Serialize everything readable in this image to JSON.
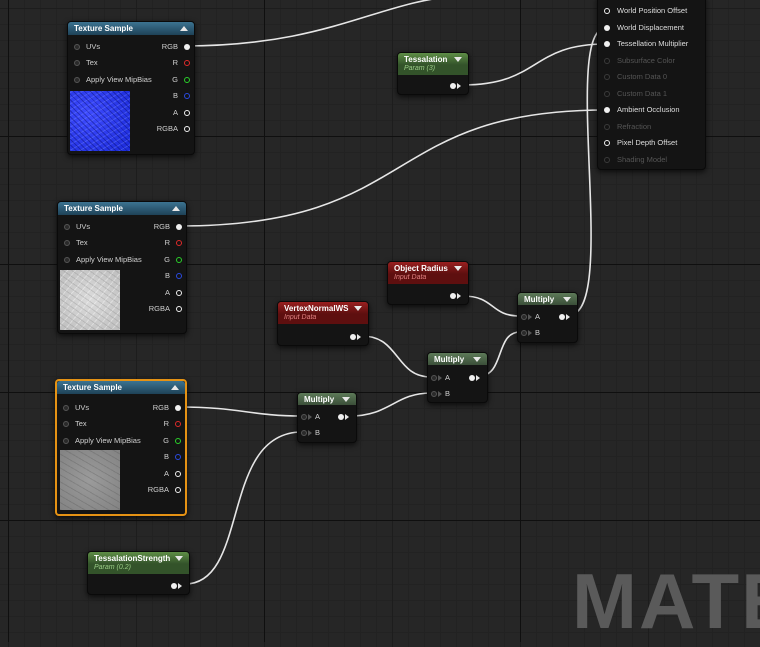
{
  "watermark": "MATE",
  "texture_sample_1": {
    "title": "Texture Sample",
    "pins_in": [
      "UVs",
      "Tex",
      "Apply View MipBias"
    ],
    "pins_out": [
      "RGB",
      "R",
      "G",
      "B",
      "A",
      "RGBA"
    ],
    "preview": "blue-normal-texture"
  },
  "texture_sample_2": {
    "title": "Texture Sample",
    "pins_in": [
      "UVs",
      "Tex",
      "Apply View MipBias"
    ],
    "pins_out": [
      "RGB",
      "R",
      "G",
      "B",
      "A",
      "RGBA"
    ],
    "preview": "white-noise-texture"
  },
  "texture_sample_3": {
    "title": "Texture Sample",
    "pins_in": [
      "UVs",
      "Tex",
      "Apply View MipBias"
    ],
    "pins_out": [
      "RGB",
      "R",
      "G",
      "B",
      "A",
      "RGBA"
    ],
    "preview": "gray-texture",
    "selected": true
  },
  "tessalation_param": {
    "title": "Tessalation",
    "subtitle": "Param (3)"
  },
  "tessalation_strength_param": {
    "title": "TessalationStrength",
    "subtitle": "Param (0.2)"
  },
  "vertex_normal_ws": {
    "title": "VertexNormalWS",
    "subtitle": "Input Data"
  },
  "object_radius": {
    "title": "Object Radius",
    "subtitle": "Input Data"
  },
  "multiply_1": {
    "title": "Multiply",
    "pins_in": [
      "A",
      "B"
    ]
  },
  "multiply_2": {
    "title": "Multiply",
    "pins_in": [
      "A",
      "B"
    ]
  },
  "multiply_3": {
    "title": "Multiply",
    "pins_in": [
      "A",
      "B"
    ]
  },
  "material_node": {
    "pins": [
      {
        "label": "World Position Offset",
        "active": true
      },
      {
        "label": "World Displacement",
        "active": true
      },
      {
        "label": "Tessellation Multiplier",
        "active": true
      },
      {
        "label": "Subsurface Color",
        "active": false
      },
      {
        "label": "Custom Data 0",
        "active": false
      },
      {
        "label": "Custom Data 1",
        "active": false
      },
      {
        "label": "Ambient Occlusion",
        "active": true
      },
      {
        "label": "Refraction",
        "active": false
      },
      {
        "label": "Pixel Depth Offset",
        "active": true
      },
      {
        "label": "Shading Model",
        "active": false
      }
    ]
  },
  "colors": {
    "grid_bg": "#262626",
    "selection": "#e59214",
    "texture_header": "#3c7391",
    "param_header": "#5e8e46",
    "input_data_header": "#9a2020",
    "math_header": "#5d7a58"
  }
}
